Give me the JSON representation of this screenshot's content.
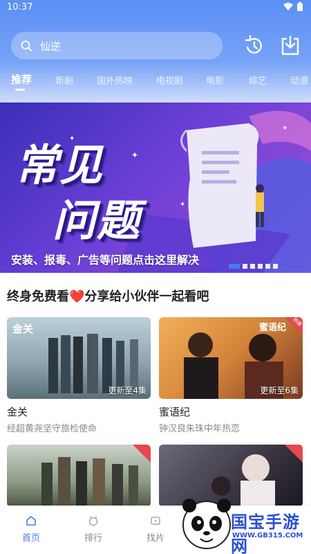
{
  "status": {
    "time": "10:37"
  },
  "search": {
    "value": "仙逆"
  },
  "tabs": [
    {
      "label": "推荐"
    },
    {
      "label": "新剧"
    },
    {
      "label": "国外热映"
    },
    {
      "label": "电视剧"
    },
    {
      "label": "电影"
    },
    {
      "label": "综艺"
    },
    {
      "label": "动漫"
    }
  ],
  "banner": {
    "line1": "常见",
    "line2": "问题",
    "caption": "安装、报毒、广告等问题点击这里解决",
    "slide_count": 6,
    "active_slide": 1
  },
  "section": {
    "title": "终身免费看❤️分享给小伙伴一起看吧"
  },
  "cards": [
    {
      "title": "金关",
      "desc": "经超黄尧坚守旅检使命",
      "episode": "更新至4集",
      "thumb_text": "金关",
      "hot": false
    },
    {
      "title": "蜜语纪",
      "desc": "钟汉良朱珠中年热恋",
      "episode": "更新至6集",
      "thumb_text": "蜜语纪",
      "hot": true
    },
    {
      "title": "",
      "desc": "",
      "episode": "",
      "thumb_text": "",
      "hot": true
    },
    {
      "title": "",
      "desc": "",
      "episode": "",
      "thumb_text": "",
      "hot": true
    }
  ],
  "hot_label": "热播",
  "nav": [
    {
      "label": "首页",
      "icon": "home-icon"
    },
    {
      "label": "排行",
      "icon": "ranking-icon"
    },
    {
      "label": "找片",
      "icon": "find-icon"
    }
  ],
  "watermark": {
    "brand": "国宝手游网",
    "url": "WWW.GB315.COM"
  },
  "colors": {
    "accent": "#4a7cf3",
    "header": "#5b8ff5",
    "banner": "#6a3fd6"
  }
}
